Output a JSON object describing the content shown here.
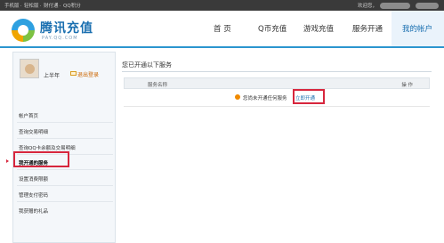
{
  "topbar": {
    "links": [
      "手机版",
      "轻松版",
      "财付通",
      "QQ积分"
    ],
    "separator": "·",
    "welcome": "欢迎您，"
  },
  "header": {
    "brand": "腾讯充值",
    "brand_sub": "PAY.QQ.COM",
    "nav": [
      {
        "label": "首 页"
      },
      {
        "label": "Q币充值"
      },
      {
        "label": "游戏充值"
      },
      {
        "label": "服务开通"
      },
      {
        "label": "我的帐户",
        "active": true
      }
    ]
  },
  "sidebar": {
    "username": "上半年",
    "logout": "退出登录",
    "items": [
      {
        "label": "帐户首页"
      },
      {
        "label": "查询交易明细"
      },
      {
        "label": "查询QQ卡余额及交易明细"
      },
      {
        "label": "我开通的服务",
        "active": true
      },
      {
        "label": "设置消费限额"
      },
      {
        "label": "管理支付密码"
      },
      {
        "label": "我获赠的礼品"
      }
    ]
  },
  "main": {
    "title": "您已开通以下服务",
    "columns": [
      "服务名称",
      "操 作"
    ],
    "empty_message": "您尚未开通任何服务",
    "open_link": "立即开通"
  },
  "colors": {
    "accent": "#1a6fb0",
    "highlight_border": "#d7263d",
    "topbar_bg": "#3a3a3a"
  }
}
